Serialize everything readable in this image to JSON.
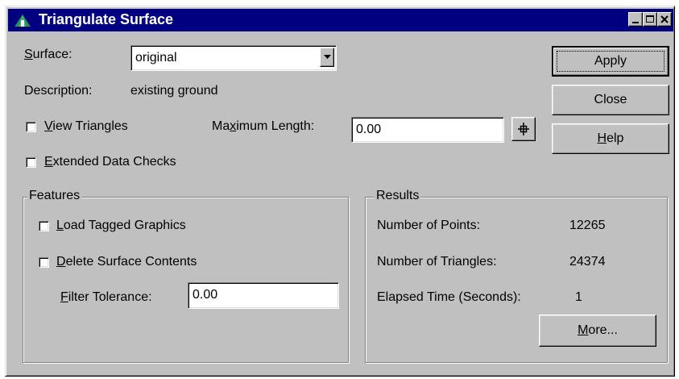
{
  "window": {
    "title": "Triangulate Surface",
    "icon": "triangulate-app-icon",
    "controls": [
      "minimize-icon",
      "maximize-icon",
      "close-icon"
    ]
  },
  "surface": {
    "label_prefix": "",
    "label_accel": "S",
    "label_rest": "urface:",
    "selected": "original"
  },
  "description": {
    "label": "Description:",
    "value": "existing ground"
  },
  "options": {
    "view_triangles": {
      "accel": "V",
      "rest": "iew Triangles",
      "checked": false
    },
    "extended_checks": {
      "accel": "E",
      "rest": "xtended Data Checks",
      "checked": false
    }
  },
  "max_length": {
    "label_pre": "Ma",
    "label_accel": "x",
    "label_rest": "imum Length:",
    "value": "0.00",
    "locate_icon": "crosshair-icon"
  },
  "buttons": {
    "apply": "Apply",
    "close": "Close",
    "help_accel": "H",
    "help_rest": "elp",
    "more_accel": "M",
    "more_rest": "ore..."
  },
  "features": {
    "title": "Features",
    "load_tagged": {
      "accel": "L",
      "rest": "oad Tagged Graphics",
      "checked": false
    },
    "delete_contents": {
      "accel": "D",
      "rest": "elete Surface Contents",
      "checked": false
    },
    "filter": {
      "accel": "F",
      "rest": "ilter Tolerance:",
      "value": "0.00"
    }
  },
  "results": {
    "title": "Results",
    "rows": [
      {
        "label": "Number of Points:",
        "value": "12265"
      },
      {
        "label": "Number of Triangles:",
        "value": "24374"
      },
      {
        "label": "Elapsed Time (Seconds):",
        "value": "1"
      }
    ]
  },
  "colors": {
    "titlebar": "#000080",
    "face": "#c0c0c0"
  }
}
